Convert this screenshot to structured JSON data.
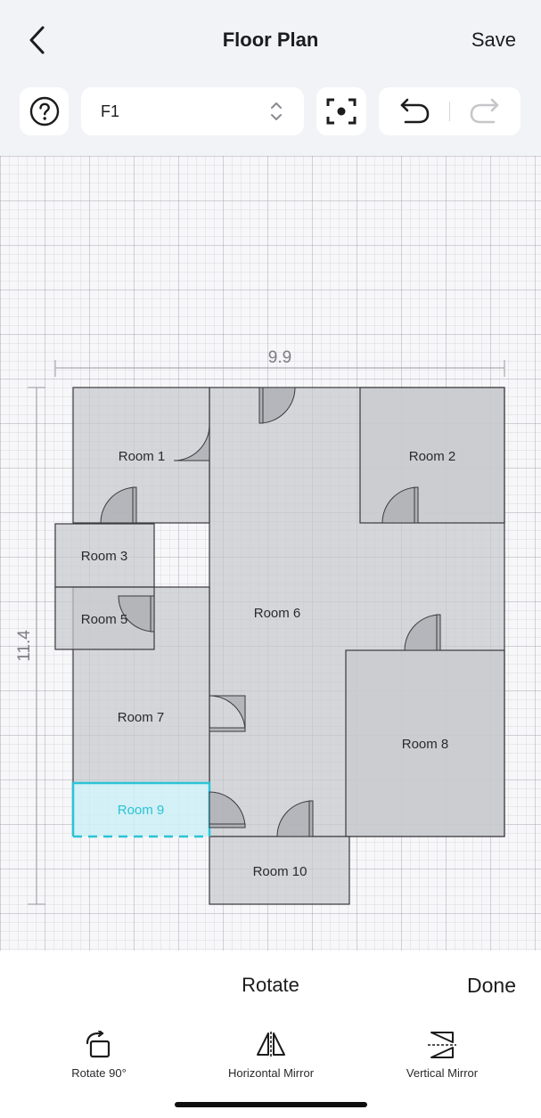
{
  "header": {
    "title": "Floor Plan",
    "save_label": "Save"
  },
  "toolbar": {
    "floor_value": "F1",
    "icons": [
      "help-circle-icon",
      "chevron-updown-icon",
      "focus-center-icon",
      "undo-icon",
      "redo-icon"
    ]
  },
  "canvas": {
    "width_dimension": "9.9",
    "height_dimension": "11.4",
    "rooms": [
      "Room 1",
      "Room 2",
      "Room 3",
      "Room 5",
      "Room 6",
      "Room 7",
      "Room 8",
      "Room 9",
      "Room 10"
    ],
    "selected_room": "Room 9"
  },
  "panel": {
    "title": "Rotate",
    "done_label": "Done",
    "tools": [
      "Rotate 90°",
      "Horizontal Mirror",
      "Vertical Mirror"
    ]
  },
  "colors": {
    "room_fill": "#d6d7da",
    "wall": "#3a3a3e",
    "selected": "#2bc3d6",
    "selected_fill": "#dcf3f7",
    "grid_bg": "#f7f7f9"
  }
}
